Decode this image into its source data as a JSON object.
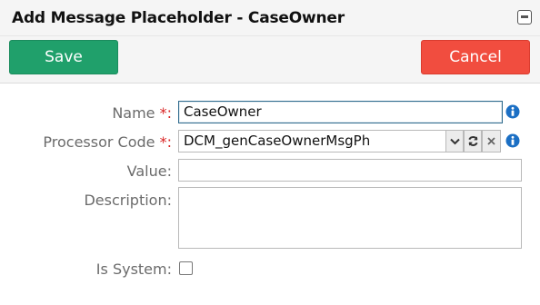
{
  "window": {
    "title": "Add Message Placeholder - CaseOwner"
  },
  "toolbar": {
    "save_label": "Save",
    "cancel_label": "Cancel"
  },
  "form": {
    "name": {
      "label": "Name",
      "required_mark": "*:",
      "value": "CaseOwner"
    },
    "processor_code": {
      "label": "Processor Code",
      "required_mark": "*:",
      "value": "DCM_genCaseOwnerMsgPh"
    },
    "value": {
      "label": "Value:",
      "value": ""
    },
    "description": {
      "label": "Description:",
      "value": ""
    },
    "is_system": {
      "label": "Is System:",
      "checked": false
    }
  },
  "colors": {
    "save": "#20a06b",
    "cancel": "#f14d3f",
    "info": "#1b6fc4",
    "required": "#d92222"
  }
}
